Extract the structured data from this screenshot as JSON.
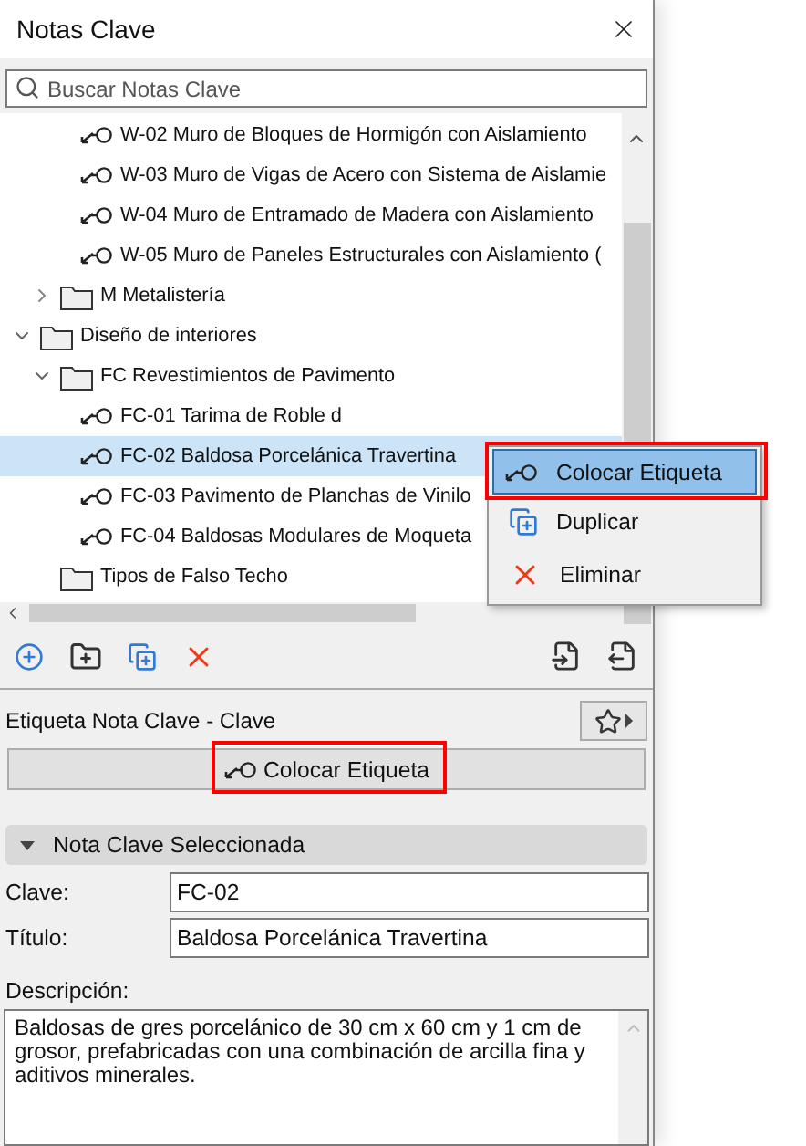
{
  "window": {
    "title": "Notas Clave"
  },
  "search": {
    "placeholder": "Buscar Notas Clave"
  },
  "tree": [
    {
      "children": [
        {
          "children": [
            {
              "label": "W-02 Muro de Bloques de Hormigón con Aislamiento",
              "kind": "note",
              "selected": false
            },
            {
              "label": "W-03 Muro de Vigas de Acero con Sistema de Aislamie",
              "kind": "note",
              "selected": false
            },
            {
              "label": "W-04 Muro de Entramado de Madera con Aislamiento",
              "kind": "note",
              "selected": false
            },
            {
              "label": "W-05 Muro de Paneles Estructurales con Aislamiento (",
              "kind": "note",
              "selected": false
            }
          ]
        },
        {
          "label": "M Metalistería",
          "kind": "folder",
          "expanded": false
        }
      ]
    },
    {
      "label": "Diseño de interiores",
      "kind": "folder",
      "expanded": true,
      "children": [
        {
          "label": "FC Revestimientos de Pavimento",
          "kind": "folder",
          "expanded": true,
          "children": [
            {
              "label": "FC-01 Tarima de Roble d",
              "kind": "note",
              "selected": false
            },
            {
              "label": "FC-02 Baldosa Porcelánica Travertina",
              "kind": "note",
              "selected": true
            },
            {
              "label": "FC-03 Pavimento de Planchas de Vinilo",
              "kind": "note",
              "selected": false
            },
            {
              "label": "FC-04 Baldosas Modulares de Moqueta",
              "kind": "note",
              "selected": false
            }
          ]
        },
        {
          "label": "Tipos de Falso Techo",
          "kind": "folder"
        }
      ]
    }
  ],
  "context_menu": [
    {
      "label": "Colocar Etiqueta",
      "kind": "tag",
      "selected": true,
      "highlighted": true
    },
    {
      "label": "Duplicar",
      "kind": "duplicate",
      "selected": false,
      "highlighted": false
    },
    {
      "label": "Eliminar",
      "kind": "delete",
      "selected": false,
      "highlighted": false
    }
  ],
  "label_section": {
    "title": "Etiqueta Nota Clave - Clave",
    "button": "Colocar Etiqueta",
    "highlighted": true
  },
  "selected_note": {
    "header": "Nota Clave Seleccionada",
    "expanded": true,
    "fields": [
      {
        "label": "Clave:",
        "value": "FC-02"
      },
      {
        "label": "Título:",
        "value": "Baldosa Porcelánica Travertina"
      }
    ],
    "description_label": "Descripción:",
    "description": "Baldosas de gres porcelánico de 30 cm x 60 cm y 1 cm de grosor, prefabricadas con una combinación de arcilla fina y aditivos minerales."
  }
}
